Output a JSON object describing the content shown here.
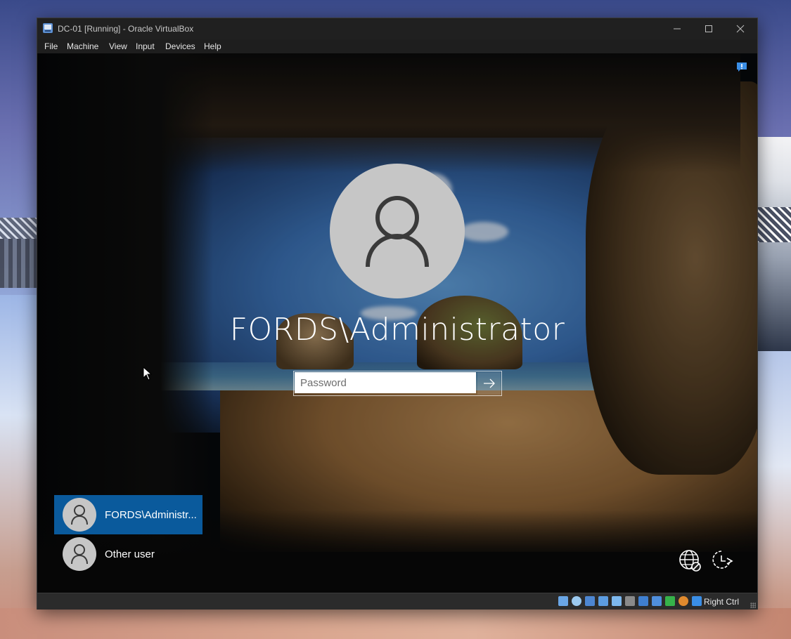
{
  "window": {
    "title": "DC-01 [Running] - Oracle VirtualBox",
    "controls": {
      "minimize": "minimize-icon",
      "maximize": "maximize-icon",
      "close": "close-icon"
    }
  },
  "menu": [
    "File",
    "Machine",
    "View",
    "Input",
    "Devices",
    "Help"
  ],
  "login": {
    "username": "FORDS\\Administrator",
    "password_placeholder": "Password",
    "submit_icon": "arrow-right-icon"
  },
  "user_list": [
    {
      "label": "FORDS\\Administr...",
      "selected": true
    },
    {
      "label": "Other user",
      "selected": false
    }
  ],
  "system_buttons": [
    "network-icon",
    "ease-of-access-icon"
  ],
  "statusbar": {
    "icons": [
      "hard-disk-icon",
      "optical-drive-icon",
      "audio-icon",
      "network-adapter-icon",
      "usb-icon",
      "shared-folders-icon",
      "display-icon",
      "recording-icon",
      "capture-icon",
      "mouse-integration-icon",
      "keyboard-icon"
    ],
    "host_key": "Right Ctrl"
  },
  "colors": {
    "selected_tile": "#0a5a9c",
    "window_bg": "#202020"
  }
}
